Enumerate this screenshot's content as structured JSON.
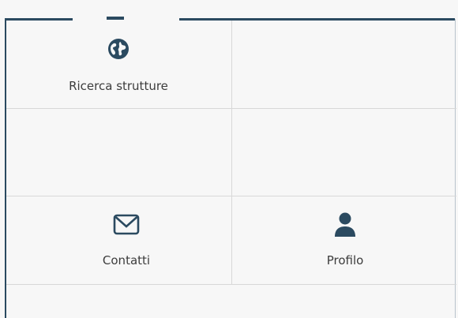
{
  "tiles": [
    {
      "label": "Ricerca strutture",
      "icon": "globe-icon"
    },
    {
      "label": "Contatti",
      "icon": "envelope-icon"
    },
    {
      "label": "Profilo",
      "icon": "user-icon"
    }
  ],
  "colors": {
    "frame_border": "#2b4a60",
    "icon": "#2b4a60",
    "grid_line": "#d8d8d8",
    "background": "#f7f7f7",
    "label_text": "#3c3c3c"
  }
}
